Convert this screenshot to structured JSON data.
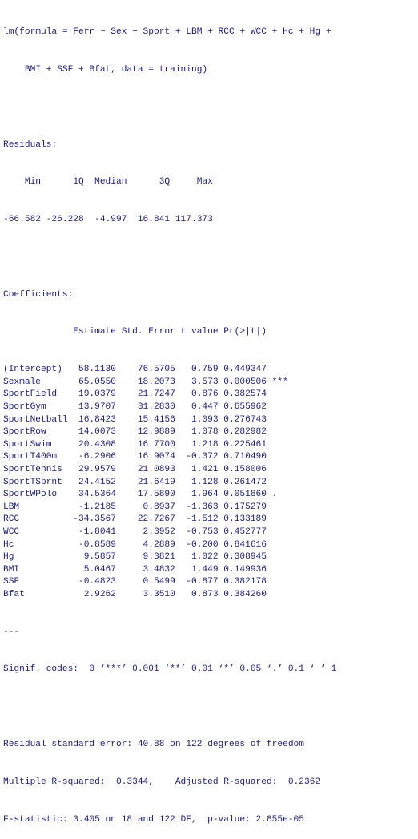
{
  "call": {
    "line1": "lm(formula = Ferr ~ Sex + Sport + LBM + RCC + WCC + Hc + Hg +",
    "line2": "    BMI + SSF + Bfat, data = training)"
  },
  "residuals": {
    "label": "Residuals:",
    "header": "    Min      1Q  Median      3Q     Max ",
    "values": "-66.582 -26.228  -4.997  16.841 117.373 "
  },
  "coefficients": {
    "label": "Coefficients:",
    "header": "             Estimate Std. Error t value Pr(>|t|)    ",
    "rows": [
      "(Intercept)   58.1130    76.5705   0.759 0.449347    ",
      "Sexmale       65.0550    18.2073   3.573 0.000506 ***",
      "SportField    19.0379    21.7247   0.876 0.382574    ",
      "SportGym      13.9707    31.2830   0.447 0.655962    ",
      "SportNetball  16.8423    15.4156   1.093 0.276743    ",
      "SportRow      14.0073    12.9889   1.078 0.282982    ",
      "SportSwim     20.4308    16.7700   1.218 0.225461    ",
      "SportT400m    -6.2906    16.9074  -0.372 0.710490    ",
      "SportTennis   29.9579    21.0893   1.421 0.158006    ",
      "SportTSprnt   24.4152    21.6419   1.128 0.261472    ",
      "SportWPolo    34.5364    17.5890   1.964 0.051860 .  ",
      "LBM           -1.2185     0.8937  -1.363 0.175279    ",
      "RCC          -34.3567    22.7267  -1.512 0.133189    ",
      "WCC           -1.8041     2.3952  -0.753 0.452777    ",
      "Hc            -0.8589     4.2889  -0.200 0.841616    ",
      "Hg             9.5857     9.3821   1.022 0.308945    ",
      "BMI            5.0467     3.4832   1.449 0.149936    ",
      "SSF           -0.4823     0.5499  -0.877 0.382178    ",
      "Bfat           2.9262     3.3510   0.873 0.384260    "
    ],
    "separator": "---",
    "signif": "Signif. codes:  0 ‘***’ 0.001 ‘**’ 0.01 ‘*’ 0.05 ‘.’ 0.1 ‘ ’ 1"
  },
  "summary": {
    "rse": "Residual standard error: 40.88 on 122 degrees of freedom",
    "r2": "Multiple R-squared:  0.3344,\tAdjusted R-squared:  0.2362 ",
    "fstat": "F-statistic: 3.405 on 18 and 122 DF,  p-value: 2.855e-05"
  }
}
